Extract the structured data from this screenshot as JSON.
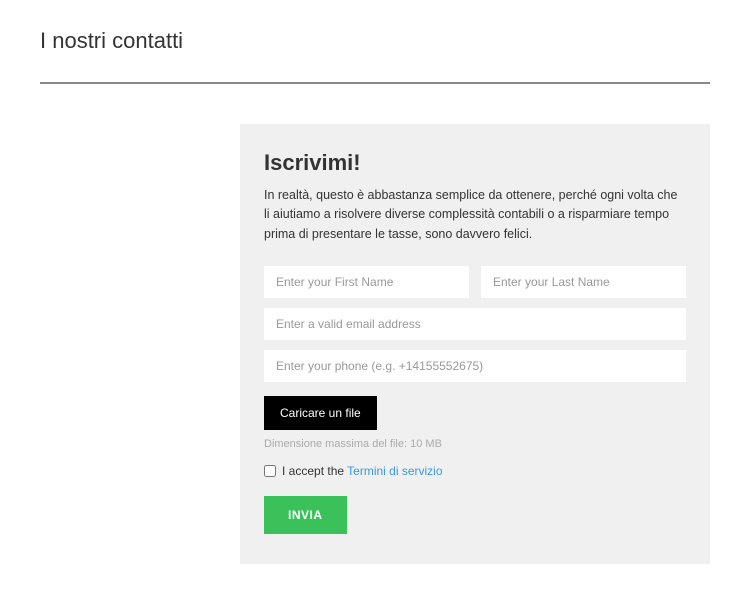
{
  "page": {
    "title": "I nostri contatti"
  },
  "form": {
    "heading": "Iscrivimi!",
    "description": "In realtà, questo è abbastanza semplice da ottenere, perché ogni volta che li aiutiamo a risolvere diverse complessità contabili o a risparmiare tempo prima di presentare le tasse, sono davvero felici.",
    "first_name": {
      "value": "",
      "placeholder": "Enter your First Name"
    },
    "last_name": {
      "value": "",
      "placeholder": "Enter your Last Name"
    },
    "email": {
      "value": "",
      "placeholder": "Enter a valid email address"
    },
    "phone": {
      "value": "",
      "placeholder": "Enter your phone (e.g. +14155552675)"
    },
    "upload_label": "Caricare un file",
    "file_note": "Dimensione massima del file: 10 MB",
    "consent_prefix": "I accept the ",
    "consent_link_text": "Termini di servizio",
    "submit_label": "INVIA"
  },
  "colors": {
    "accent_green": "#3bc15a",
    "link_blue": "#3b99d8",
    "card_bg": "#f0f0f0"
  }
}
